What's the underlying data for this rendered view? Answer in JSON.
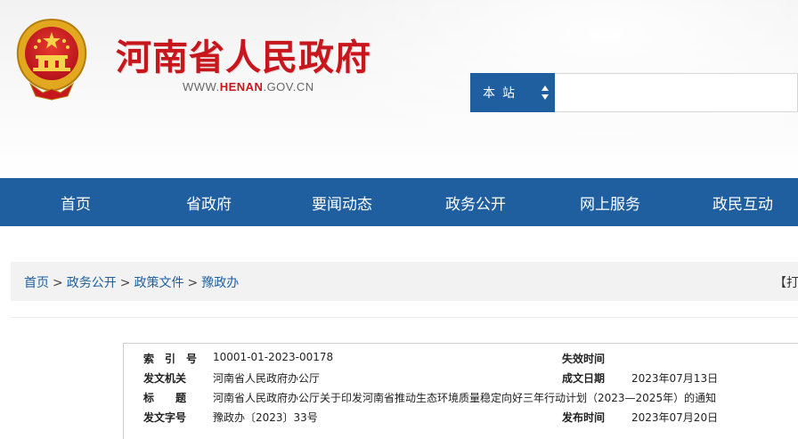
{
  "header": {
    "site_title": "河南省人民政府",
    "url_prefix": "WWW.",
    "url_highlight": "HENAN",
    "url_suffix": ".GOV.CN",
    "emblem_icon": "national-emblem-icon"
  },
  "search": {
    "scope_label": "本站",
    "value": "",
    "placeholder": ""
  },
  "nav": {
    "items": [
      "首页",
      "省政府",
      "要闻动态",
      "政务公开",
      "网上服务",
      "政民互动"
    ]
  },
  "breadcrumb": {
    "items": [
      "首页",
      "政务公开",
      "政策文件",
      "豫政办"
    ],
    "separator": ">",
    "print_label": "【打印"
  },
  "document_info": {
    "index_label": "索　引　号",
    "index_value": "10001-01-2023-00178",
    "expiry_label": "失效时间",
    "expiry_value": "",
    "issuer_label": "发文机关",
    "issuer_value": "河南省人民政府办公厅",
    "created_label": "成文日期",
    "created_value": "2023年07月13日",
    "title_label": "标　　题",
    "title_value": "河南省人民政府办公厅关于印发河南省推动生态环境质量稳定向好三年行动计划（2023—2025年）的通知",
    "docno_label": "发文字号",
    "docno_value": "豫政办〔2023〕33号",
    "published_label": "发布时间",
    "published_value": "2023年07月20日"
  },
  "colors": {
    "brand_red": "#c8161d",
    "nav_blue": "#1f5fa0"
  }
}
